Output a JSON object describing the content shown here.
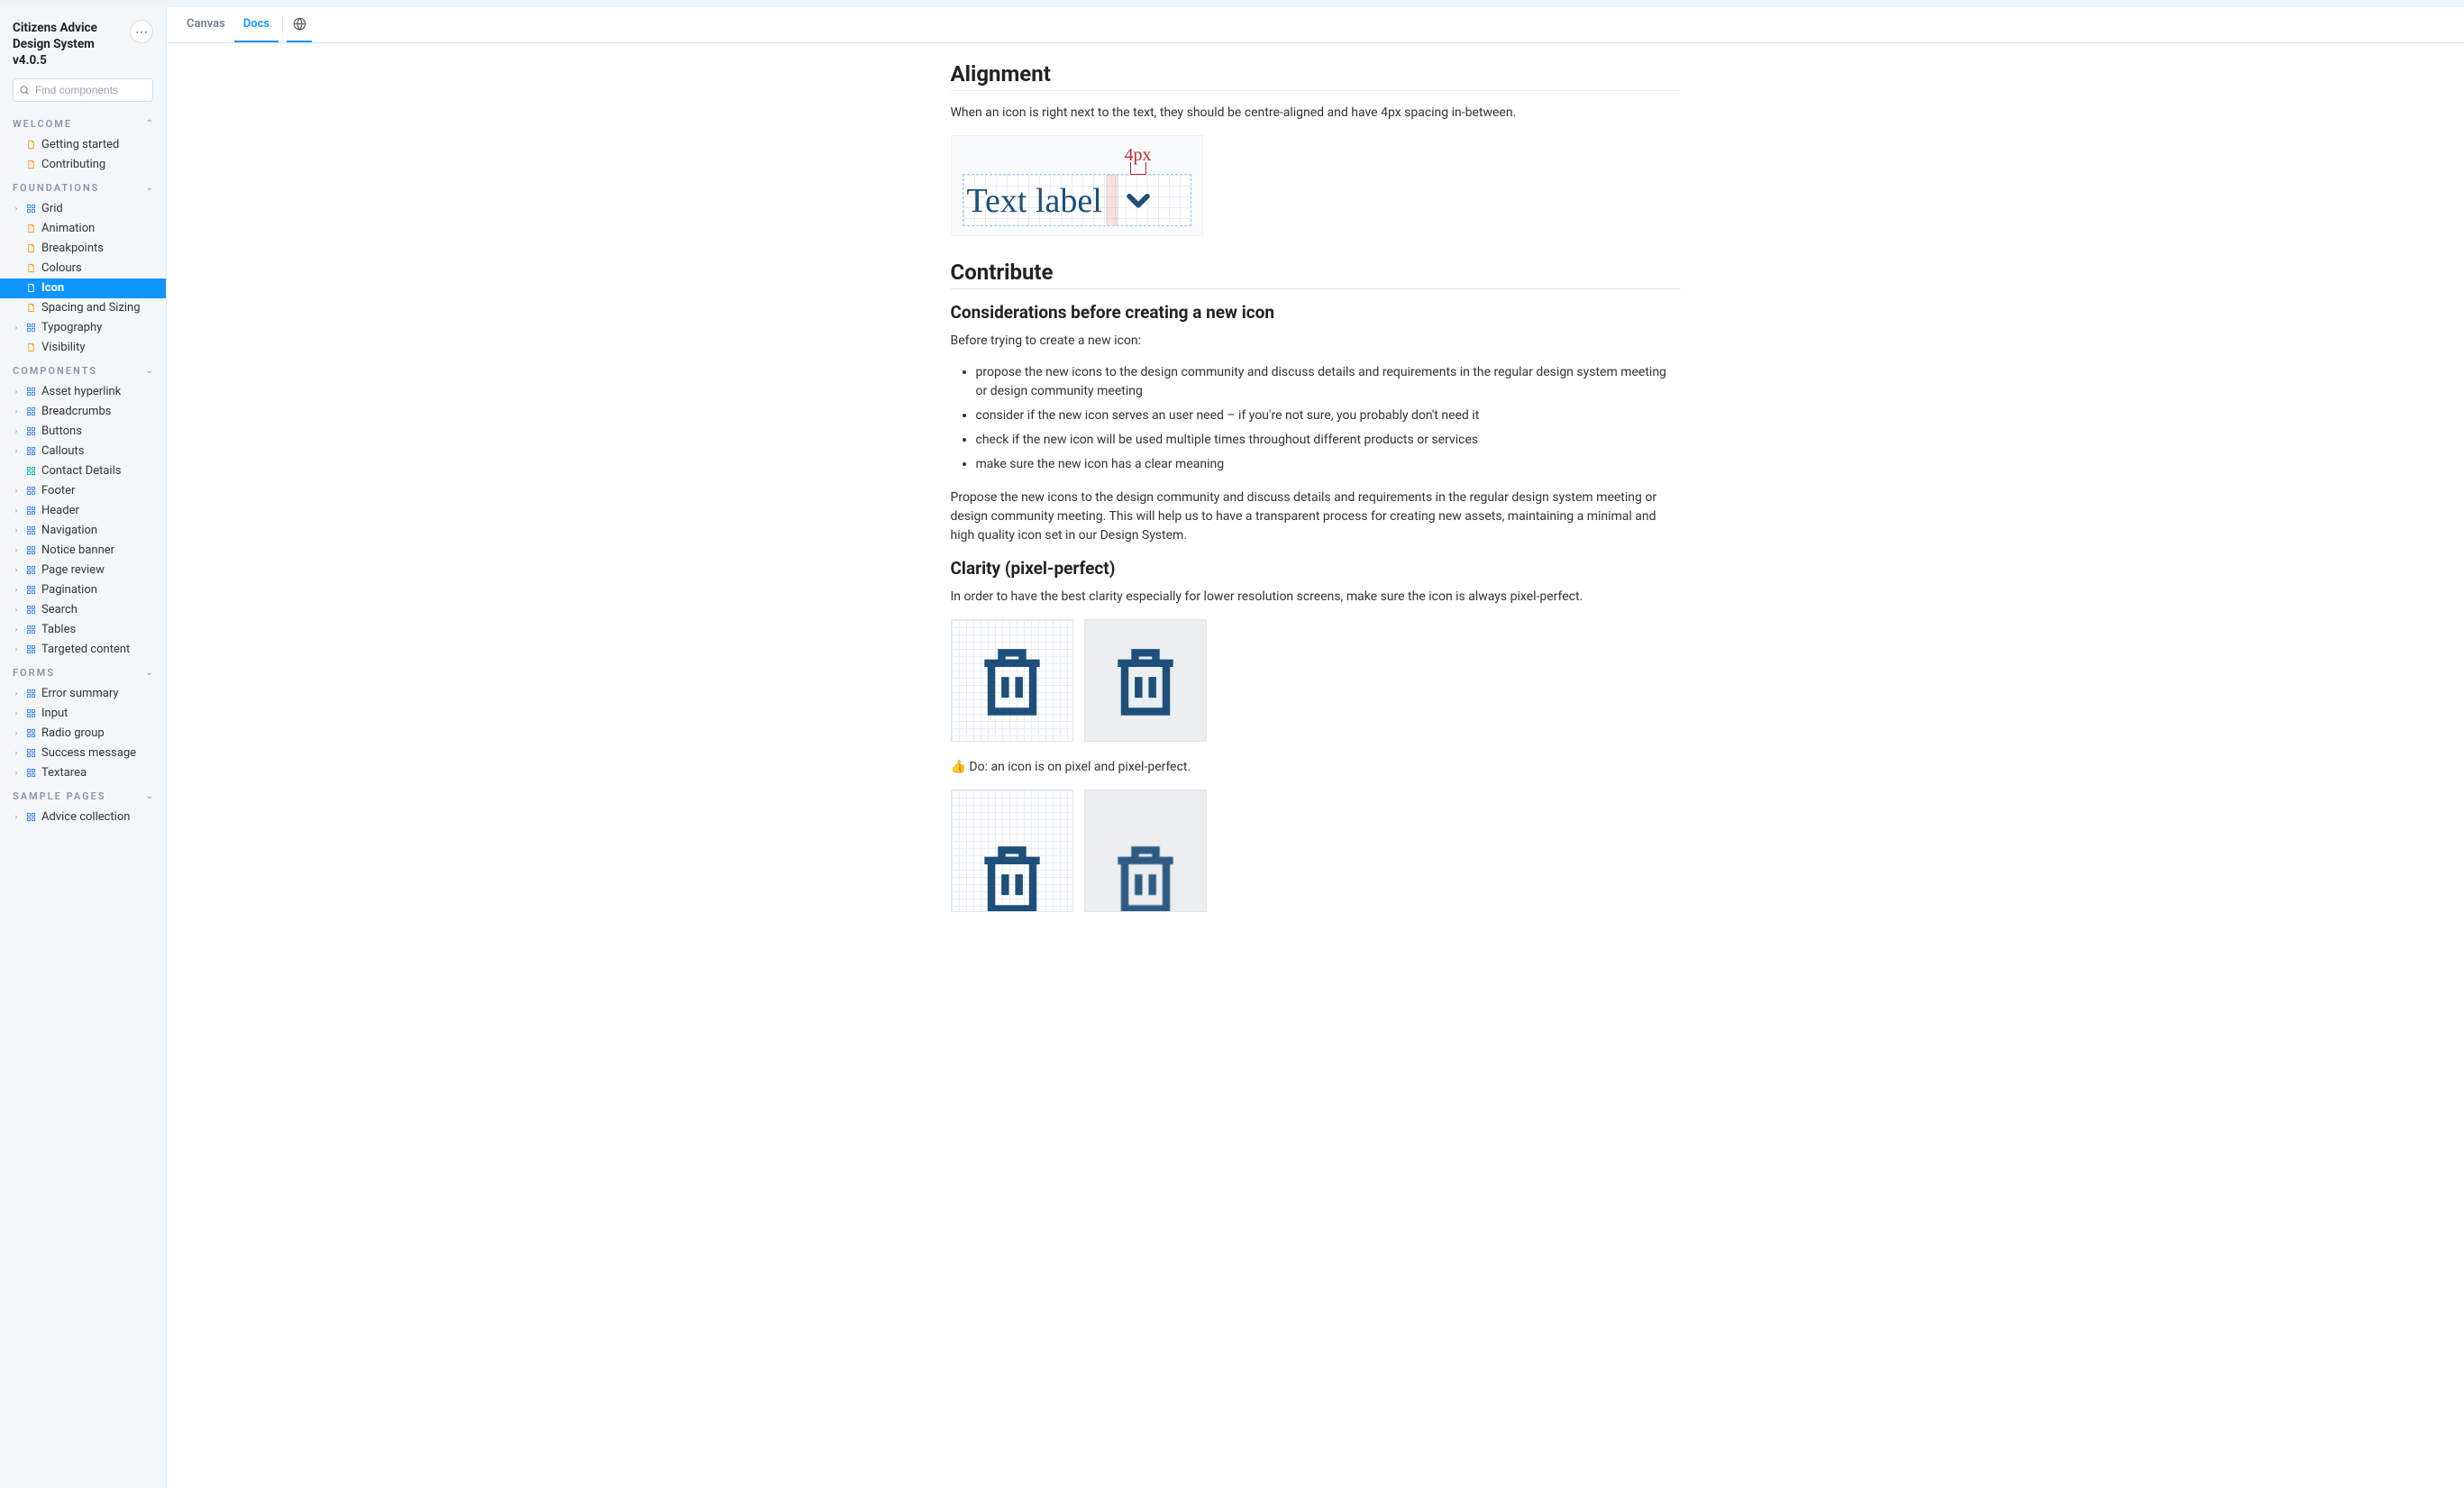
{
  "header": {
    "title": "Citizens Advice Design System v4.0.5"
  },
  "search": {
    "placeholder": "Find components",
    "shortcut": "/"
  },
  "tabs": {
    "canvas": "Canvas",
    "docs": "Docs"
  },
  "nav": {
    "groups": [
      {
        "key": "welcome",
        "title": "WELCOME",
        "chevron": "collapse",
        "items": [
          {
            "label": "Getting started",
            "iconColor": "orange",
            "iconKind": "doc",
            "caret": false
          },
          {
            "label": "Contributing",
            "iconColor": "orange",
            "iconKind": "doc",
            "caret": false
          }
        ]
      },
      {
        "key": "foundations",
        "title": "FOUNDATIONS",
        "chevron": "expand",
        "items": [
          {
            "label": "Grid",
            "iconColor": "blue",
            "iconKind": "grid",
            "caret": true
          },
          {
            "label": "Animation",
            "iconColor": "orange",
            "iconKind": "doc",
            "caret": false
          },
          {
            "label": "Breakpoints",
            "iconColor": "orange",
            "iconKind": "doc",
            "caret": false
          },
          {
            "label": "Colours",
            "iconColor": "orange",
            "iconKind": "doc",
            "caret": false
          },
          {
            "label": "Icon",
            "iconColor": "orange",
            "iconKind": "doc",
            "caret": false,
            "active": true
          },
          {
            "label": "Spacing and Sizing",
            "iconColor": "orange",
            "iconKind": "doc",
            "caret": false
          },
          {
            "label": "Typography",
            "iconColor": "blue",
            "iconKind": "grid",
            "caret": true
          },
          {
            "label": "Visibility",
            "iconColor": "orange",
            "iconKind": "doc",
            "caret": false
          }
        ]
      },
      {
        "key": "components",
        "title": "COMPONENTS",
        "chevron": "expand",
        "items": [
          {
            "label": "Asset hyperlink",
            "iconColor": "blue",
            "iconKind": "grid",
            "caret": true
          },
          {
            "label": "Breadcrumbs",
            "iconColor": "blue",
            "iconKind": "grid",
            "caret": true
          },
          {
            "label": "Buttons",
            "iconColor": "blue",
            "iconKind": "grid",
            "caret": true
          },
          {
            "label": "Callouts",
            "iconColor": "blue",
            "iconKind": "grid",
            "caret": true
          },
          {
            "label": "Contact Details",
            "iconColor": "teal",
            "iconKind": "grid",
            "caret": false
          },
          {
            "label": "Footer",
            "iconColor": "blue",
            "iconKind": "grid",
            "caret": true
          },
          {
            "label": "Header",
            "iconColor": "blue",
            "iconKind": "grid",
            "caret": true
          },
          {
            "label": "Navigation",
            "iconColor": "blue",
            "iconKind": "grid",
            "caret": true
          },
          {
            "label": "Notice banner",
            "iconColor": "blue",
            "iconKind": "grid",
            "caret": true
          },
          {
            "label": "Page review",
            "iconColor": "blue",
            "iconKind": "grid",
            "caret": true
          },
          {
            "label": "Pagination",
            "iconColor": "blue",
            "iconKind": "grid",
            "caret": true
          },
          {
            "label": "Search",
            "iconColor": "blue",
            "iconKind": "grid",
            "caret": true
          },
          {
            "label": "Tables",
            "iconColor": "blue",
            "iconKind": "grid",
            "caret": true
          },
          {
            "label": "Targeted content",
            "iconColor": "blue",
            "iconKind": "grid",
            "caret": true
          }
        ]
      },
      {
        "key": "forms",
        "title": "FORMS",
        "chevron": "expand",
        "items": [
          {
            "label": "Error summary",
            "iconColor": "blue",
            "iconKind": "grid",
            "caret": true
          },
          {
            "label": "Input",
            "iconColor": "blue",
            "iconKind": "grid",
            "caret": true
          },
          {
            "label": "Radio group",
            "iconColor": "blue",
            "iconKind": "grid",
            "caret": true
          },
          {
            "label": "Success message",
            "iconColor": "blue",
            "iconKind": "grid",
            "caret": true
          },
          {
            "label": "Textarea",
            "iconColor": "blue",
            "iconKind": "grid",
            "caret": true
          }
        ]
      },
      {
        "key": "sample",
        "title": "SAMPLE PAGES",
        "chevron": "expand",
        "items": [
          {
            "label": "Advice collection",
            "iconColor": "blue",
            "iconKind": "grid",
            "caret": true
          }
        ]
      }
    ]
  },
  "doc": {
    "alignment_h": "Alignment",
    "alignment_p": "When an icon is right next to the text, they should be centre-aligned and have 4px spacing in-between.",
    "align_figure": {
      "spacing_label": "4px",
      "text_label": "Text label"
    },
    "contribute_h": "Contribute",
    "considerations_h": "Considerations before creating a new icon",
    "considerations_intro": "Before trying to create a new icon:",
    "considerations_list": [
      "propose the new icons to the design community and discuss details and requirements in the regular design system meeting or design community meeting",
      "consider if the new icon serves an user need – if you're not sure, you probably don't need it",
      "check if the new icon will be used multiple times throughout different products or services",
      "make sure the new icon has a clear meaning"
    ],
    "considerations_outro": "Propose the new icons to the design community and discuss details and requirements in the regular design system meeting or design community meeting. This will help us to have a transparent process for creating new assets, maintaining a minimal and high quality icon set in our Design System.",
    "clarity_h": "Clarity (pixel-perfect)",
    "clarity_p": "In order to have the best clarity especially for lower resolution screens, make sure the icon is always pixel-perfect.",
    "clarity_do": "👍 Do: an icon is on pixel and pixel-perfect."
  }
}
